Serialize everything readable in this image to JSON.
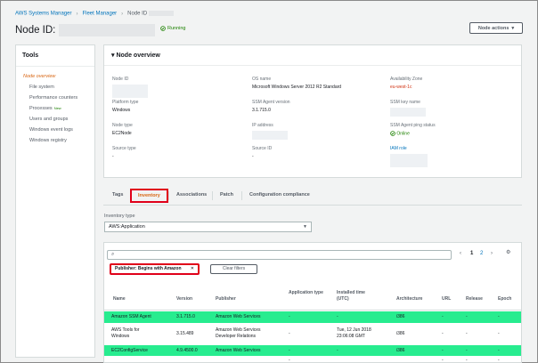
{
  "breadcrumb": {
    "items": [
      "AWS Systems Manager",
      "Fleet Manager",
      "Node ID"
    ]
  },
  "header": {
    "title": "Node ID:",
    "status": "Running",
    "actions_button": "Node actions"
  },
  "tools": {
    "title": "Tools",
    "items": [
      "Node overview",
      "File system",
      "Performance counters",
      "Processes",
      "Users and groups",
      "Windows event logs",
      "Windows registry"
    ],
    "new_badge": "New"
  },
  "overview": {
    "title": "Node overview",
    "fields": {
      "node_id": {
        "label": "Node ID",
        "value": ""
      },
      "platform_type": {
        "label": "Platform type",
        "value": "Windows"
      },
      "node_type": {
        "label": "Node type",
        "value": "EC2Node"
      },
      "source_type": {
        "label": "Source type",
        "value": "-"
      },
      "os_name": {
        "label": "OS name",
        "value": "Microsoft Windows Server 2012 R2 Standard"
      },
      "ssm_version": {
        "label": "SSM Agent version",
        "value": "3.1.715.0"
      },
      "ip_address": {
        "label": "IP address",
        "value": ""
      },
      "source_id": {
        "label": "Source ID",
        "value": "-"
      },
      "az": {
        "label": "Availability Zone",
        "value": "eu-west-1c"
      },
      "key_name": {
        "label": "SSM key name",
        "value": ""
      },
      "ping": {
        "label": "SSM Agent ping status",
        "value": "Online"
      },
      "iam": {
        "label": "IAM role",
        "value": ""
      }
    }
  },
  "tabs": [
    "Tags",
    "Inventory",
    "Associations",
    "Patch",
    "Configuration compliance"
  ],
  "inventory": {
    "type_label": "Inventory type",
    "type_value": "AWS:Application"
  },
  "table": {
    "search_placeholder": "",
    "page_prev": "‹",
    "pages": [
      "1",
      "2"
    ],
    "page_next": "›",
    "filter_chip": "Publisher: Begins with Amazon",
    "clear_filters": "Clear filters",
    "headers": [
      "Name",
      "Version",
      "Publisher",
      "Application type",
      "Installed time (UTC)",
      "Architecture",
      "URL",
      "Release",
      "Epoch"
    ],
    "rows": [
      {
        "name": "Amazon SSM Agent",
        "version": "3.1.715.0",
        "publisher": "Amazon Web Services",
        "apptype": "-",
        "installed": "-",
        "arch": "i386",
        "url": "-",
        "release": "-",
        "epoch": "-",
        "hl": true
      },
      {
        "name": "AWS Tools for Windows",
        "version": "3.15.489",
        "publisher": "Amazon Web Services Developer Relations",
        "apptype": "-",
        "installed": "Tue, 12 Jun 2018 23:06:08 GMT",
        "arch": "i386",
        "url": "-",
        "release": "-",
        "epoch": "-",
        "hl": false
      },
      {
        "name": "EC2ConfigService",
        "version": "4.9.4500.0",
        "publisher": "Amazon Web Services",
        "apptype": "-",
        "installed": "-",
        "arch": "i386",
        "url": "-",
        "release": "-",
        "epoch": "-",
        "hl": true
      },
      {
        "name": "",
        "version": "",
        "publisher": "",
        "apptype": "-",
        "installed": "",
        "arch": "",
        "url": "-",
        "release": "-",
        "epoch": "-",
        "hl": false
      }
    ]
  }
}
